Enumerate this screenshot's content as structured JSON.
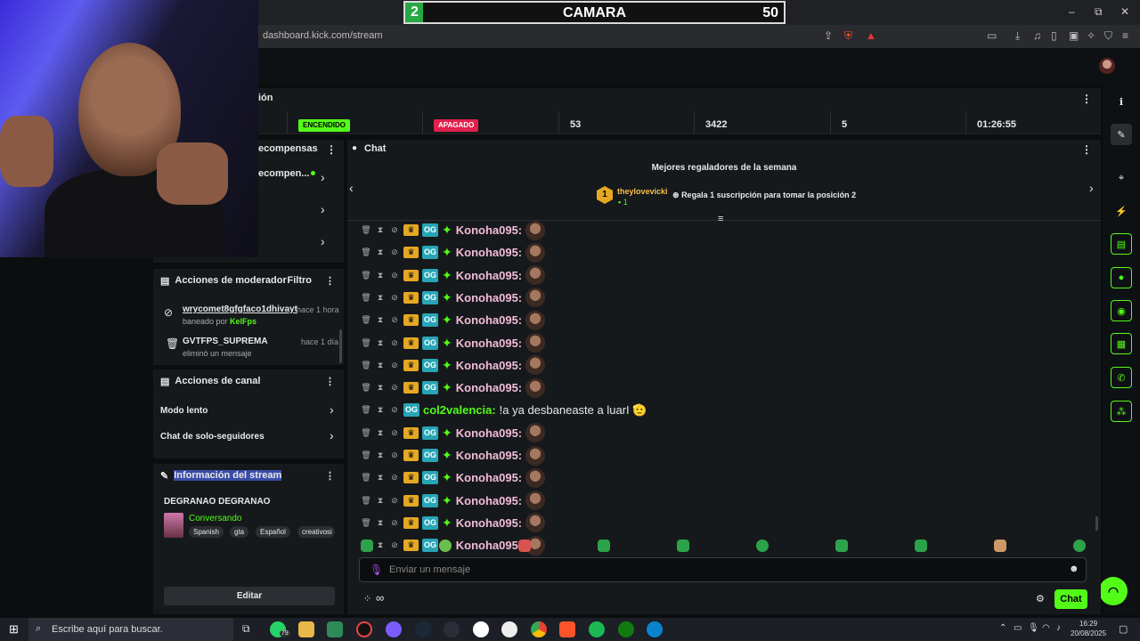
{
  "browser": {
    "url": "dashboard.kick.com/stream",
    "window_controls": [
      "–",
      "⧉",
      "✕"
    ]
  },
  "scoreboard": {
    "left": "2",
    "title": "CAMARA",
    "right": "50"
  },
  "stats": {
    "title_fragment": "ión",
    "cells": [
      {
        "badge": "ENCENDIDO",
        "kind": "on"
      },
      {
        "badge": "APAGADO",
        "kind": "off"
      },
      {
        "value": "53"
      },
      {
        "value": "3422"
      },
      {
        "value": "5"
      },
      {
        "value": "01:26:55"
      }
    ]
  },
  "rewards": {
    "title_fragment": "ecompensas",
    "item_fragment": "ecompen..."
  },
  "mod_actions": {
    "title": "Acciones de moderador",
    "filter": "Filtro",
    "items": [
      {
        "user": "wrycomet8gfgfaco1dhivayt",
        "time": "hace 1 hora",
        "desc_prefix": "baneado por ",
        "desc_actor": "KelFps"
      },
      {
        "user": "GVTFPS_SUPREMA",
        "time": "hace 1 día",
        "desc_prefix": "eliminó un mensaje",
        "desc_actor": ""
      }
    ]
  },
  "channel_actions": {
    "title": "Acciones de canal",
    "items": [
      "Modo lento",
      "Chat de solo-seguidores"
    ]
  },
  "stream_info": {
    "title": "Información del stream",
    "stream_title": "DEGRANAO DEGRANAO",
    "category": "Conversando",
    "tags": [
      "Spanish",
      "gta",
      "Español",
      "creativosi"
    ],
    "edit": "Editar"
  },
  "chat": {
    "title": "Chat",
    "gifters_title": "Mejores regaladores de la semana",
    "top_gifter": {
      "rank": "1",
      "name": "theylovevicki",
      "count": "1"
    },
    "gift_cta": "Regala 1 suscripción para tomar la posición 2",
    "messages": [
      {
        "user": "Konoha095:",
        "text": "",
        "crown": true,
        "spark": true,
        "green": false
      },
      {
        "user": "Konoha095:",
        "text": "",
        "crown": true,
        "spark": true,
        "green": false
      },
      {
        "user": "Konoha095:",
        "text": "",
        "crown": true,
        "spark": true,
        "green": false
      },
      {
        "user": "Konoha095:",
        "text": "",
        "crown": true,
        "spark": true,
        "green": false
      },
      {
        "user": "Konoha095:",
        "text": "",
        "crown": true,
        "spark": true,
        "green": false
      },
      {
        "user": "Konoha095:",
        "text": "",
        "crown": true,
        "spark": true,
        "green": false
      },
      {
        "user": "Konoha095:",
        "text": "",
        "crown": true,
        "spark": true,
        "green": false
      },
      {
        "user": "Konoha095:",
        "text": "",
        "crown": true,
        "spark": true,
        "green": false
      },
      {
        "user": "col2valencia:",
        "text": "!a ya desbaneaste a luarI 🫡",
        "crown": false,
        "spark": false,
        "green": true
      },
      {
        "user": "Konoha095:",
        "text": "",
        "crown": true,
        "spark": true,
        "green": false
      },
      {
        "user": "Konoha095:",
        "text": "",
        "crown": true,
        "spark": true,
        "green": false
      },
      {
        "user": "Konoha095:",
        "text": "",
        "crown": true,
        "spark": true,
        "green": false
      },
      {
        "user": "Konoha095:",
        "text": "",
        "crown": true,
        "spark": true,
        "green": false
      },
      {
        "user": "Konoha095:",
        "text": "",
        "crown": true,
        "spark": true,
        "green": false
      },
      {
        "user": "Konoha095:",
        "text": "",
        "crown": true,
        "spark": true,
        "green": false
      }
    ],
    "input_placeholder": "Enviar un mensaje",
    "points": "∞",
    "send_label": "Chat"
  },
  "taskbar": {
    "search_placeholder": "Escribe aquí para buscar.",
    "whatsapp_badge": "79",
    "time": "16:29",
    "date": "20/08/2025"
  },
  "colors": {
    "accent": "#53fc18",
    "offline": "#e1204c",
    "username": "#f3bcd9"
  }
}
